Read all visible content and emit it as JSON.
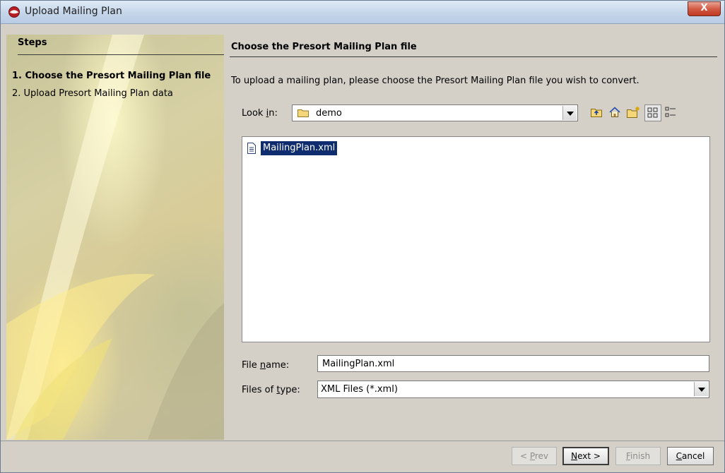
{
  "window": {
    "title": "Upload Mailing Plan",
    "close_label": "X"
  },
  "steps": {
    "header": "Steps",
    "items": [
      {
        "label": "1. Choose the Presort Mailing Plan file",
        "current": true
      },
      {
        "label": "2. Upload Presort Mailing Plan data",
        "current": false
      }
    ]
  },
  "main": {
    "header": "Choose the Presort Mailing Plan file",
    "instruction": "To upload a mailing plan, please choose the Presort Mailing Plan file you wish to convert."
  },
  "chooser": {
    "look_in": {
      "label_pre": "Look ",
      "label_mn": "i",
      "label_post": "n:",
      "value": "demo"
    },
    "toolbar": [
      "up-one-level-icon",
      "home-icon",
      "new-folder-icon",
      "list-view-icon",
      "details-view-icon"
    ],
    "files": [
      {
        "name": "MailingPlan.xml",
        "selected": true
      }
    ],
    "file_name": {
      "label_pre": "File ",
      "label_mn": "n",
      "label_post": "ame:",
      "value": "MailingPlan.xml"
    },
    "file_type": {
      "label_pre": "Files of ",
      "label_mn": "t",
      "label_post": "ype:",
      "value": "XML Files (*.xml)"
    }
  },
  "buttons": {
    "prev": {
      "pre": "< ",
      "mn": "P",
      "post": "rev"
    },
    "next": {
      "pre": "",
      "mn": "N",
      "post": "ext >"
    },
    "finish": {
      "pre": "",
      "mn": "F",
      "post": "inish"
    },
    "cancel": {
      "pre": "",
      "mn": "C",
      "post": "ancel"
    }
  },
  "colors": {
    "selection": "#0f2d6e",
    "dialog_bg": "#d4d0c8"
  }
}
